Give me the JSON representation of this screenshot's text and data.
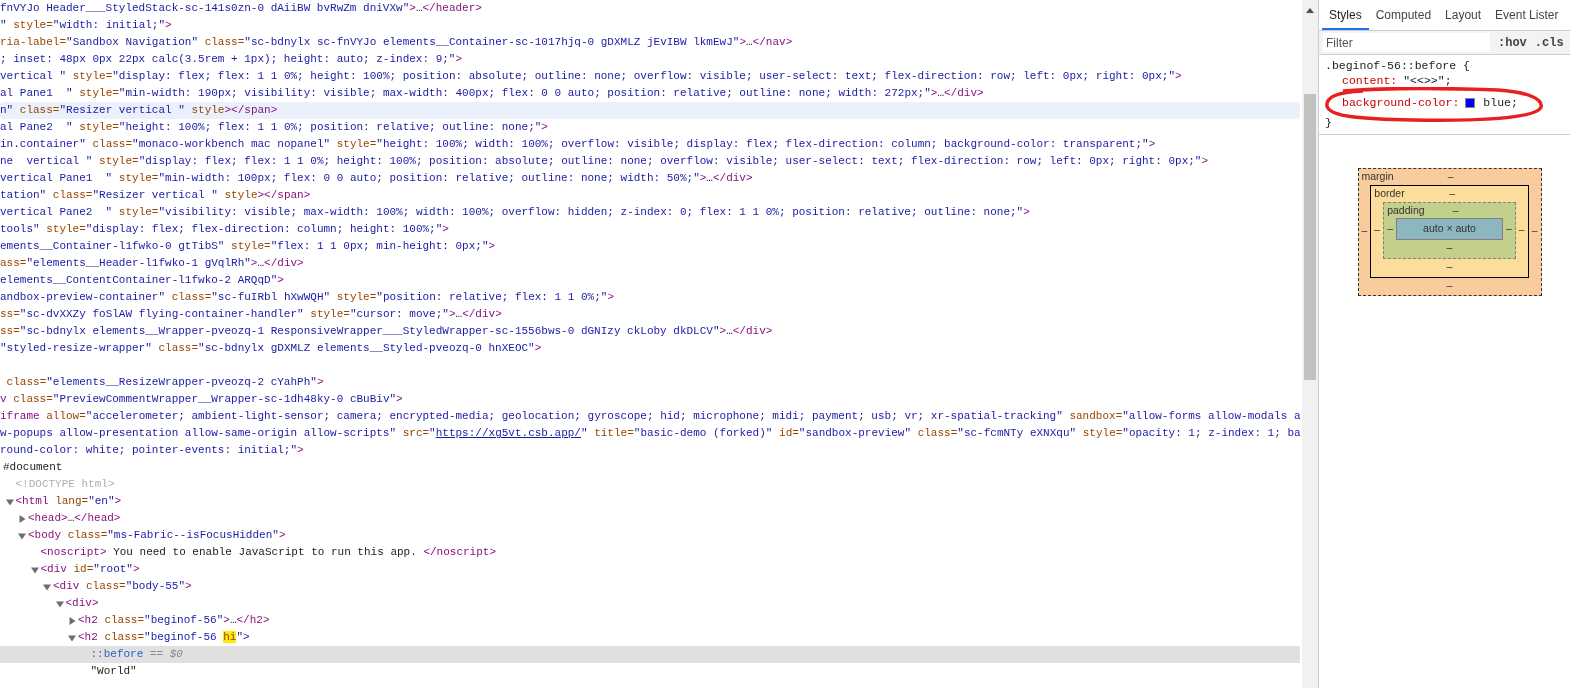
{
  "elements": {
    "lines": [
      {
        "kind": "value",
        "text": "fnVYJo Header___StyledStack-sc-141s0zn-0 dAiiBW bvRwZm dniVXw\">…</header>",
        "hovered": false
      },
      {
        "kind": "value",
        "text": "\" style=\"width: initial;\">",
        "hovered": false
      },
      {
        "kind": "attr",
        "text": "ria-label=\"Sandbox Navigation\" class=\"sc-bdnylx sc-fnVYJo elements__Container-sc-1017hjq-0 gDXMLZ jEvIBW lkmEwJ\">…</nav>",
        "hovered": false
      },
      {
        "kind": "value",
        "text": "; inset: 48px 0px 22px calc(3.5rem + 1px); height: auto; z-index: 9;\">",
        "hovered": false
      },
      {
        "kind": "value",
        "text": "vertical \" style=\"display: flex; flex: 1 1 0%; height: 100%; position: absolute; outline: none; overflow: visible; user-select: text; flex-direction: row; left: 0px; right: 0px;\">",
        "hovered": false
      },
      {
        "kind": "value",
        "text": "al Pane1  \" style=\"min-width: 190px; visibility: visible; max-width: 400px; flex: 0 0 auto; position: relative; outline: none; width: 272px;\">…</div>",
        "hovered": false
      },
      {
        "kind": "value",
        "text": "n\" class=\"Resizer vertical \" style></span>",
        "hovered": true
      },
      {
        "kind": "value",
        "text": "al Pane2  \" style=\"height: 100%; flex: 1 1 0%; position: relative; outline: none;\">",
        "hovered": false
      },
      {
        "kind": "value",
        "text": "in.container\" class=\"monaco-workbench mac nopanel\" style=\"height: 100%; width: 100%; overflow: visible; display: flex; flex-direction: column; background-color: transparent;\">",
        "hovered": false
      },
      {
        "kind": "value",
        "text": "ne  vertical \" style=\"display: flex; flex: 1 1 0%; height: 100%; position: absolute; outline: none; overflow: visible; user-select: text; flex-direction: row; left: 0px; right: 0px;\">",
        "hovered": false
      },
      {
        "kind": "value",
        "text": "vertical Pane1  \" style=\"min-width: 100px; flex: 0 0 auto; position: relative; outline: none; width: 50%;\">…</div>",
        "hovered": false
      },
      {
        "kind": "value",
        "text": "tation\" class=\"Resizer vertical \" style></span>",
        "hovered": false
      },
      {
        "kind": "value",
        "text": "vertical Pane2  \" style=\"visibility: visible; max-width: 100%; width: 100%; overflow: hidden; z-index: 0; flex: 1 1 0%; position: relative; outline: none;\">",
        "hovered": false
      },
      {
        "kind": "value",
        "text": "tools\" style=\"display: flex; flex-direction: column; height: 100%;\">",
        "hovered": false
      },
      {
        "kind": "value",
        "text": "ements__Container-l1fwko-0 gtTibS\" style=\"flex: 1 1 0px; min-height: 0px;\">",
        "hovered": false
      },
      {
        "kind": "attr",
        "text": "ass=\"elements__Header-l1fwko-1 gVqlRh\">…</div>",
        "hovered": false
      },
      {
        "kind": "value",
        "text": "elements__ContentContainer-l1fwko-2 ARQqD\">",
        "hovered": false
      },
      {
        "kind": "value",
        "text": "andbox-preview-container\" class=\"sc-fuIRbl hXwWQH\" style=\"position: relative; flex: 1 1 0%;\">",
        "hovered": false
      },
      {
        "kind": "attr",
        "text": "ss=\"sc-dvXXZy foSlAW flying-container-handler\" style=\"cursor: move;\">…</div>",
        "hovered": false
      },
      {
        "kind": "attr",
        "text": "ss=\"sc-bdnylx elements__Wrapper-pveozq-1 ResponsiveWrapper___StyledWrapper-sc-1556bws-0 dGNIzy ckLoby dkDLCV\">…</div>",
        "hovered": false
      },
      {
        "kind": "attr",
        "text": "\"styled-resize-wrapper\" class=\"sc-bdnylx gDXMLZ elements__Styled-pveozq-0 hnXEOC\">",
        "hovered": false
      },
      {
        "kind": "blank"
      },
      {
        "kind": "attr",
        "text": " class=\"elements__ResizeWrapper-pveozq-2 cYahPh\">",
        "hovered": false
      },
      {
        "kind": "tagname",
        "text": "v class=\"PreviewCommentWrapper__Wrapper-sc-1dh48ky-0 cBuBiv\">",
        "hovered": false
      },
      {
        "kind": "tagname",
        "text": "iframe allow=\"accelerometer; ambient-light-sensor; camera; encrypted-media; geolocation; gyroscope; hid; microphone; midi; payment; usb; vr; xr-spatial-tracking\" sandbox=\"allow-forms allow-modals a",
        "hovered": false
      },
      {
        "kind": "value",
        "text": "w-popups allow-presentation allow-same-origin allow-scripts\" src=\"https://xg5vt.csb.app/\" title=\"basic-demo (forked)\" id=\"sandbox-preview\" class=\"sc-fcmNTy eXNXqu\" style=\"opacity: 1; z-index: 1; ba",
        "hovered": false
      },
      {
        "kind": "value",
        "text": "round-color: white; pointer-events: initial;\">",
        "hovered": false
      }
    ],
    "tree": [
      {
        "kind": "document",
        "text": "#document",
        "selected": false,
        "children": [
          {
            "kind": "doctype",
            "text": "<!DOCTYPE html>",
            "selected": false
          },
          {
            "kind": "element",
            "text": "<html lang=\"en\">",
            "expanded": true,
            "selected": false,
            "children": [
              {
                "kind": "element",
                "text": "<head>…</head>",
                "expanded": false,
                "selected": false
              },
              {
                "kind": "element",
                "text": "<body class=\"ms-Fabric--isFocusHidden\">",
                "expanded": true,
                "selected": false,
                "children": [
                  {
                    "kind": "element",
                    "text": "<noscript> You need to enable JavaScript to run this app. </noscript>",
                    "selected": false
                  },
                  {
                    "kind": "element",
                    "text": "<div id=\"root\">",
                    "expanded": true,
                    "selected": false,
                    "children": [
                      {
                        "kind": "element",
                        "text": "<div class=\"body-55\">",
                        "expanded": true,
                        "selected": false,
                        "children": [
                          {
                            "kind": "element",
                            "text": "<div>",
                            "expanded": true,
                            "selected": false,
                            "children": [
                              {
                                "kind": "element",
                                "text": "<h2 class=\"beginof-56\">…</h2>",
                                "expanded": false,
                                "selected": false
                              },
                              {
                                "kind": "element",
                                "text": "<h2 class=\"beginof-56 ",
                                "match": "hi",
                                "text_after": "\">",
                                "expanded": true,
                                "selected": false,
                                "children": [
                                  {
                                    "kind": "pseudo",
                                    "text": "::before",
                                    "console_ref": "== $0",
                                    "selected": true
                                  },
                                  {
                                    "kind": "text",
                                    "text": "\"World\"",
                                    "selected": false
                                  }
                                ]
                              }
                            ]
                          }
                        ]
                      }
                    ]
                  }
                ]
              }
            ]
          }
        ]
      }
    ]
  },
  "sidebar": {
    "tabs": [
      {
        "label": "Styles",
        "selected": true
      },
      {
        "label": "Computed",
        "selected": false
      },
      {
        "label": "Layout",
        "selected": false
      },
      {
        "label": "Event Lister",
        "selected": false
      }
    ],
    "filter": {
      "placeholder": "Filter"
    },
    "toggles": [
      ":hov",
      ".cls"
    ],
    "rule": {
      "selector": ".beginof-56::before {",
      "close": "}",
      "declarations": [
        {
          "property": "content:",
          "value": "\"<<>>\";"
        },
        {
          "property": "background-color:",
          "value": "blue;",
          "color": "#0000ff"
        }
      ]
    },
    "box_model": {
      "margin": {
        "label": "margin",
        "top": "–",
        "right": "–",
        "bottom": "–",
        "left": "–"
      },
      "border": {
        "label": "border",
        "top": "–",
        "right": "–",
        "bottom": "–",
        "left": "–"
      },
      "padding": {
        "label": "padding",
        "top": "–",
        "right": "–",
        "bottom": "–",
        "left": "–"
      },
      "content": "auto × auto"
    }
  }
}
